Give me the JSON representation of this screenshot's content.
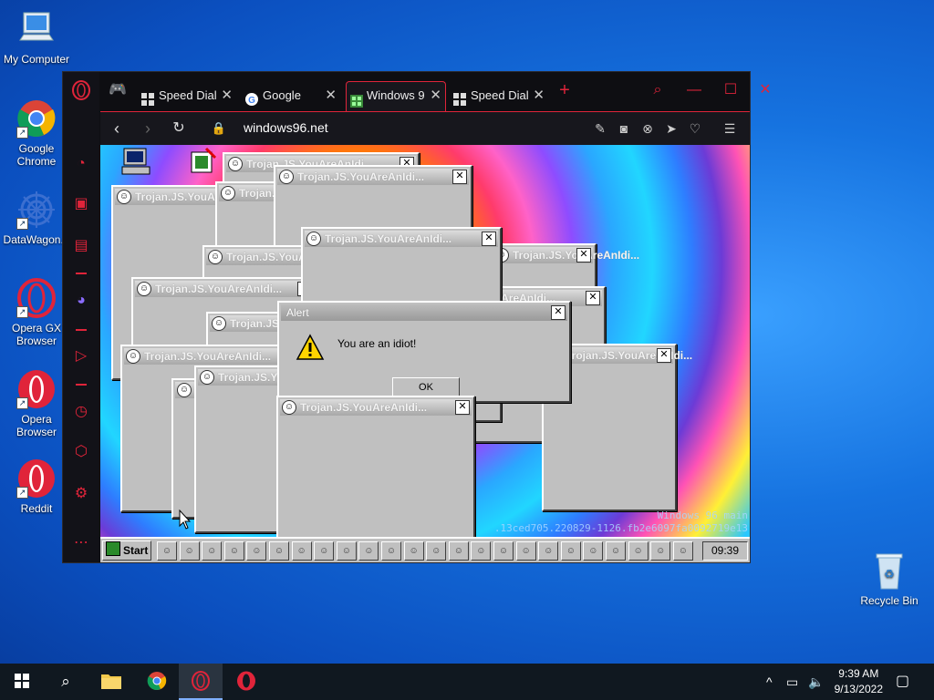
{
  "desktop": {
    "icons": [
      {
        "label": "My Computer"
      },
      {
        "label": "Google Chrome"
      },
      {
        "label": "DataWagon..."
      },
      {
        "label": "Opera GX Browser"
      },
      {
        "label": "Opera Browser"
      },
      {
        "label": "Reddit"
      },
      {
        "label": "Recycle Bin"
      }
    ]
  },
  "browser": {
    "tabs": [
      {
        "label": "Speed Dial",
        "icon": "grid-icon"
      },
      {
        "label": "Google",
        "icon": "google-icon"
      },
      {
        "label": "Windows 9",
        "icon": "windows96-icon",
        "active": true
      },
      {
        "label": "Speed Dial",
        "icon": "grid-icon"
      }
    ],
    "new_tab": "+",
    "url": "windows96.net"
  },
  "w96": {
    "trojan_title": "Trojan.JS.YouAreAnIdi...",
    "alert": {
      "title": "Alert",
      "message": "You are an idiot!",
      "ok": "OK"
    },
    "taskbar": {
      "start": "Start",
      "clock": "09:39"
    },
    "build_line1": "Windows 96 main",
    "build_line2": ".13ced705.220829-1126.fb2e6097fa0092719e13"
  },
  "taskbar": {
    "time": "9:39 AM",
    "date": "9/13/2022"
  },
  "colors": {
    "opera_accent": "#e0243a",
    "desktop_blue": "#1673e0"
  }
}
